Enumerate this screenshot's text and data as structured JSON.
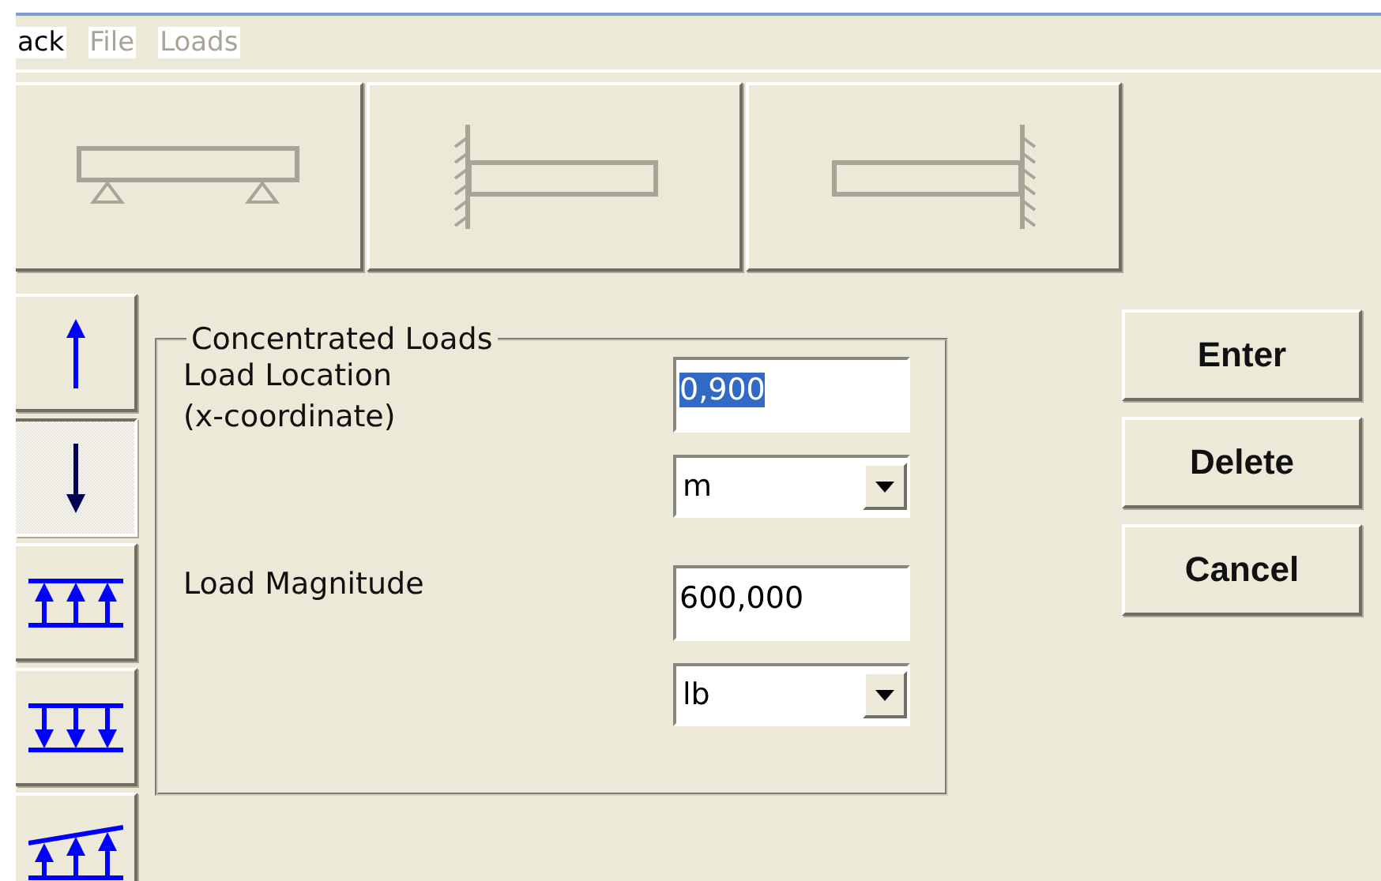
{
  "menu": [
    {
      "label": "ack",
      "disabled": false
    },
    {
      "label": "File",
      "disabled": true
    },
    {
      "label": "Loads",
      "disabled": true
    }
  ],
  "supports": [
    {
      "kind": "simple"
    },
    {
      "kind": "fixed-left"
    },
    {
      "kind": "fixed-right"
    }
  ],
  "load_types": [
    {
      "kind": "point-up",
      "selected": false
    },
    {
      "kind": "point-down",
      "selected": true
    },
    {
      "kind": "uniform-up",
      "selected": false
    },
    {
      "kind": "uniform-down",
      "selected": false
    },
    {
      "kind": "linear-up",
      "selected": false
    }
  ],
  "group": {
    "title": "Concentrated Loads",
    "location": {
      "label": "Load Location\n(x-coordinate)",
      "value": "0,900",
      "highlighted": true,
      "unit": "m"
    },
    "magnitude": {
      "label": "Load Magnitude",
      "value": "600,000",
      "highlighted": false,
      "unit": "lb"
    }
  },
  "buttons": [
    "Enter",
    "Delete",
    "Cancel"
  ]
}
